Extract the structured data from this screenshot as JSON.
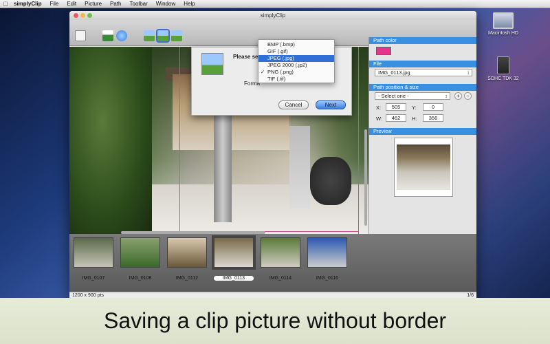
{
  "menubar": {
    "app_name": "simplyClip",
    "items": [
      "File",
      "Edit",
      "Picture",
      "Path",
      "Toolbar",
      "Window",
      "Help"
    ]
  },
  "desktop": {
    "icons": [
      {
        "label": "Macintosh HD",
        "icon": "hard-drive-icon"
      },
      {
        "label": "SDHC TDK 32",
        "icon": "sd-card-icon"
      }
    ]
  },
  "window": {
    "title": "simplyClip"
  },
  "sheet": {
    "title": "Please sele",
    "format_label": "Forma",
    "cancel_label": "Cancel",
    "next_label": "Next",
    "format_options": [
      {
        "label": "BMP (.bmp)",
        "checked": false,
        "highlighted": false
      },
      {
        "label": "GIF (.gif)",
        "checked": false,
        "highlighted": false
      },
      {
        "label": "JPEG (.jpg)",
        "checked": false,
        "highlighted": true
      },
      {
        "label": "JPEG 2000 (.jp2)",
        "checked": false,
        "highlighted": false
      },
      {
        "label": "PNG (.png)",
        "checked": true,
        "highlighted": false
      },
      {
        "label": "TIF (.tif)",
        "checked": false,
        "highlighted": false
      }
    ]
  },
  "sidebar": {
    "path_color": {
      "header": "Path color",
      "color": "#e8338a"
    },
    "file": {
      "header": "File",
      "value": "IMG_0113.jpg"
    },
    "path_position": {
      "header": "Path position & size",
      "select_value": "- Select one -",
      "x_label": "X:",
      "x": "505",
      "y_label": "Y:",
      "y": "0",
      "w_label": "W:",
      "w": "462",
      "h_label": "H:",
      "h": "356"
    },
    "preview": {
      "header": "Preview"
    }
  },
  "filmstrip": {
    "items": [
      {
        "label": "IMG_0107",
        "selected": false
      },
      {
        "label": "IMG_0108",
        "selected": false
      },
      {
        "label": "IMG_0112",
        "selected": false
      },
      {
        "label": "IMG_0113",
        "selected": true
      },
      {
        "label": "IMG_0114",
        "selected": false
      },
      {
        "label": "IMG_0116",
        "selected": false
      }
    ]
  },
  "statusbar": {
    "dimensions": "1200 x 900 pts",
    "page": "1/6"
  },
  "caption": "Saving a clip picture without border"
}
